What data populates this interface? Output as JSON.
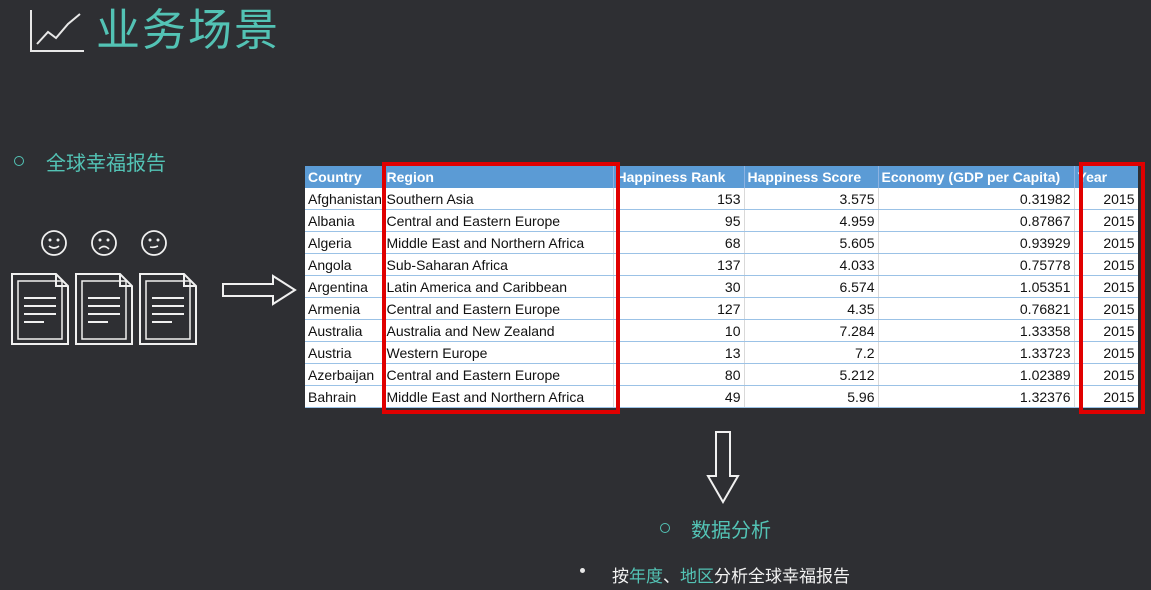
{
  "slide": {
    "title": "业务场景",
    "section1": "全球幸福报告",
    "section2": "数据分析",
    "subpoint": {
      "p1": "按",
      "h1": "年度",
      "p2": "、",
      "h2": "地区",
      "p3": "分析全球幸福报告"
    }
  },
  "icons": {
    "title": "line-chart-icon",
    "faces": [
      "smile-face-icon",
      "sad-face-icon",
      "neutral-face-icon"
    ],
    "docs": [
      "document-icon",
      "document-icon",
      "document-icon"
    ],
    "arrow_right": "arrow-right-icon",
    "arrow_down": "arrow-down-icon"
  },
  "colors": {
    "accent": "#53c3b5",
    "header": "#5b9bd5",
    "highlight": "#e00000",
    "background": "#2e2f33"
  },
  "table": {
    "headers": [
      "Country",
      "Region",
      "Happiness Rank",
      "Happiness Score",
      "Economy (GDP per Capita)",
      "Year"
    ],
    "rows": [
      [
        "Afghanistan",
        "Southern Asia",
        "153",
        "3.575",
        "0.31982",
        "2015"
      ],
      [
        "Albania",
        "Central and Eastern Europe",
        "95",
        "4.959",
        "0.87867",
        "2015"
      ],
      [
        "Algeria",
        "Middle East and Northern Africa",
        "68",
        "5.605",
        "0.93929",
        "2015"
      ],
      [
        "Angola",
        "Sub-Saharan Africa",
        "137",
        "4.033",
        "0.75778",
        "2015"
      ],
      [
        "Argentina",
        "Latin America and Caribbean",
        "30",
        "6.574",
        "1.05351",
        "2015"
      ],
      [
        "Armenia",
        "Central and Eastern Europe",
        "127",
        "4.35",
        "0.76821",
        "2015"
      ],
      [
        "Australia",
        "Australia and New Zealand",
        "10",
        "7.284",
        "1.33358",
        "2015"
      ],
      [
        "Austria",
        "Western Europe",
        "13",
        "7.2",
        "1.33723",
        "2015"
      ],
      [
        "Azerbaijan",
        "Central and Eastern Europe",
        "80",
        "5.212",
        "1.02389",
        "2015"
      ],
      [
        "Bahrain",
        "Middle East and Northern Africa",
        "49",
        "5.96",
        "1.32376",
        "2015"
      ]
    ]
  }
}
